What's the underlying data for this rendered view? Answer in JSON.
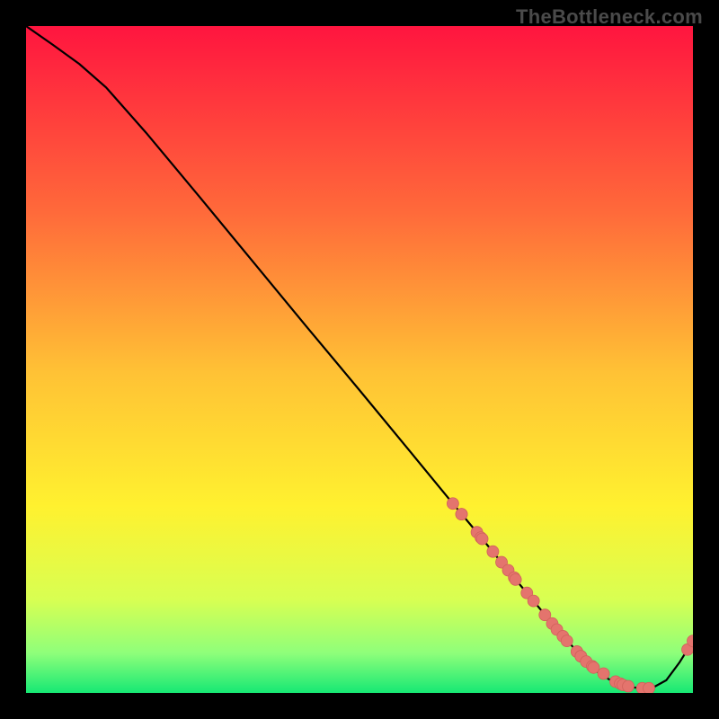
{
  "watermark": "TheBottleneck.com",
  "colors": {
    "bg": "#000000",
    "watermark": "#4a4a4a",
    "curve": "#000000",
    "marker_fill": "#e4746d",
    "marker_stroke": "#d1625b",
    "grad_top": "#ff153f",
    "grad_mid1": "#ff6a3a",
    "grad_mid2": "#ffc235",
    "grad_mid3": "#fff12f",
    "grad_mid4": "#d8ff52",
    "grad_mid5": "#8fff7a",
    "grad_bottom": "#16e874"
  },
  "chart_data": {
    "type": "line",
    "title": "",
    "xlabel": "",
    "ylabel": "",
    "xlim": [
      0,
      100
    ],
    "ylim": [
      0,
      100
    ],
    "grid": false,
    "legend": false,
    "series": [
      {
        "name": "curve",
        "x": [
          0,
          4,
          8,
          12,
          18,
          26,
          34,
          42,
          50,
          58,
          64,
          68,
          72,
          76,
          80,
          84,
          86,
          88,
          90,
          92,
          94,
          96,
          98,
          100
        ],
        "y": [
          100,
          97.2,
          94.3,
          90.8,
          84.0,
          74.4,
          64.7,
          55.0,
          45.4,
          35.7,
          28.4,
          23.6,
          18.7,
          13.9,
          9.1,
          4.7,
          2.9,
          1.7,
          1.0,
          0.7,
          0.8,
          1.9,
          4.6,
          7.8
        ]
      }
    ],
    "markers": {
      "x": [
        64.0,
        65.3,
        65.3,
        67.6,
        68.2,
        68.4,
        70.0,
        71.3,
        72.3,
        73.2,
        73.4,
        75.1,
        76.1,
        77.8,
        78.9,
        79.6,
        80.5,
        81.1,
        82.6,
        82.6,
        83.2,
        83.2,
        84.0,
        84.9,
        85.1,
        86.6,
        88.4,
        89.1,
        89.5,
        90.3,
        92.4,
        93.4,
        99.2,
        100.0
      ],
      "y": [
        28.4,
        26.8,
        26.8,
        24.1,
        23.3,
        23.1,
        21.2,
        19.6,
        18.4,
        17.3,
        17.0,
        15.0,
        13.8,
        11.7,
        10.4,
        9.5,
        8.5,
        7.8,
        6.2,
        6.2,
        5.5,
        5.5,
        4.7,
        4.0,
        3.8,
        2.9,
        1.7,
        1.4,
        1.2,
        1.0,
        0.7,
        0.7,
        6.5,
        7.8
      ]
    }
  }
}
